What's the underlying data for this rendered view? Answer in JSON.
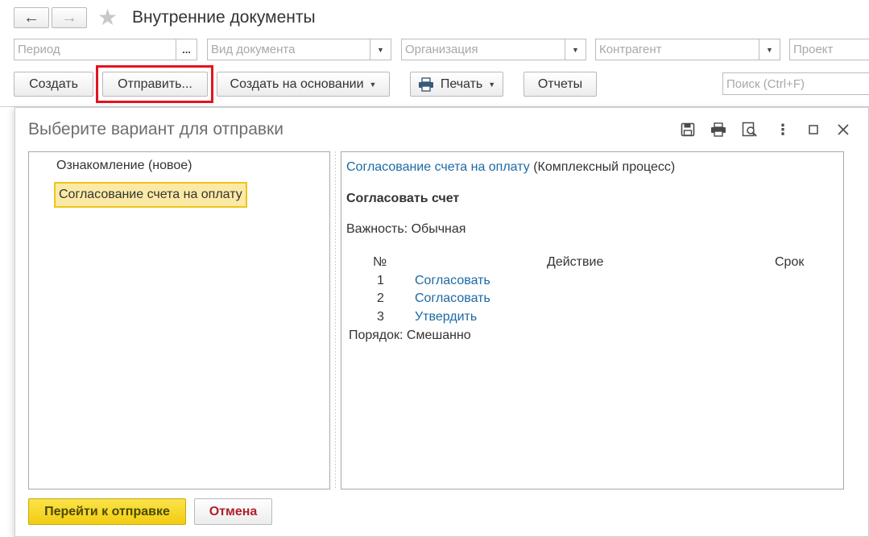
{
  "header": {
    "back_icon": "←",
    "forward_icon": "→",
    "star_icon": "★",
    "title": "Внутренние документы"
  },
  "filters": {
    "period": "Период",
    "period_button": "...",
    "doc_type": "Вид документа",
    "organization": "Организация",
    "counterparty": "Контрагент",
    "project": "Проект"
  },
  "toolbar": {
    "create": "Создать",
    "send": "Отправить...",
    "create_based": "Создать на основании",
    "print": "Печать",
    "reports": "Отчеты",
    "search_placeholder": "Поиск (Ctrl+F)"
  },
  "dialog": {
    "title": "Выберите вариант для отправки",
    "options": [
      "Ознакомление (новое)",
      "Согласование счета на оплату"
    ],
    "detail": {
      "process_link": "Согласование счета на оплату",
      "process_type": "(Комплексный процесс)",
      "task": "Согласовать счет",
      "importance_label": "Важность:",
      "importance_value": "Обычная",
      "columns": [
        "№",
        "Действие",
        "Срок"
      ],
      "rows": [
        {
          "num": "1",
          "action": "Согласовать"
        },
        {
          "num": "2",
          "action": "Согласовать"
        },
        {
          "num": "3",
          "action": "Утвердить"
        }
      ],
      "order_label": "Порядок:",
      "order_value": "Смешанно"
    },
    "buttons": {
      "go": "Перейти к отправке",
      "cancel": "Отмена"
    }
  },
  "colors": {
    "accent_yellow": "#f2cc12",
    "link_blue": "#1a6aa5",
    "highlight_red": "#e3141e"
  }
}
